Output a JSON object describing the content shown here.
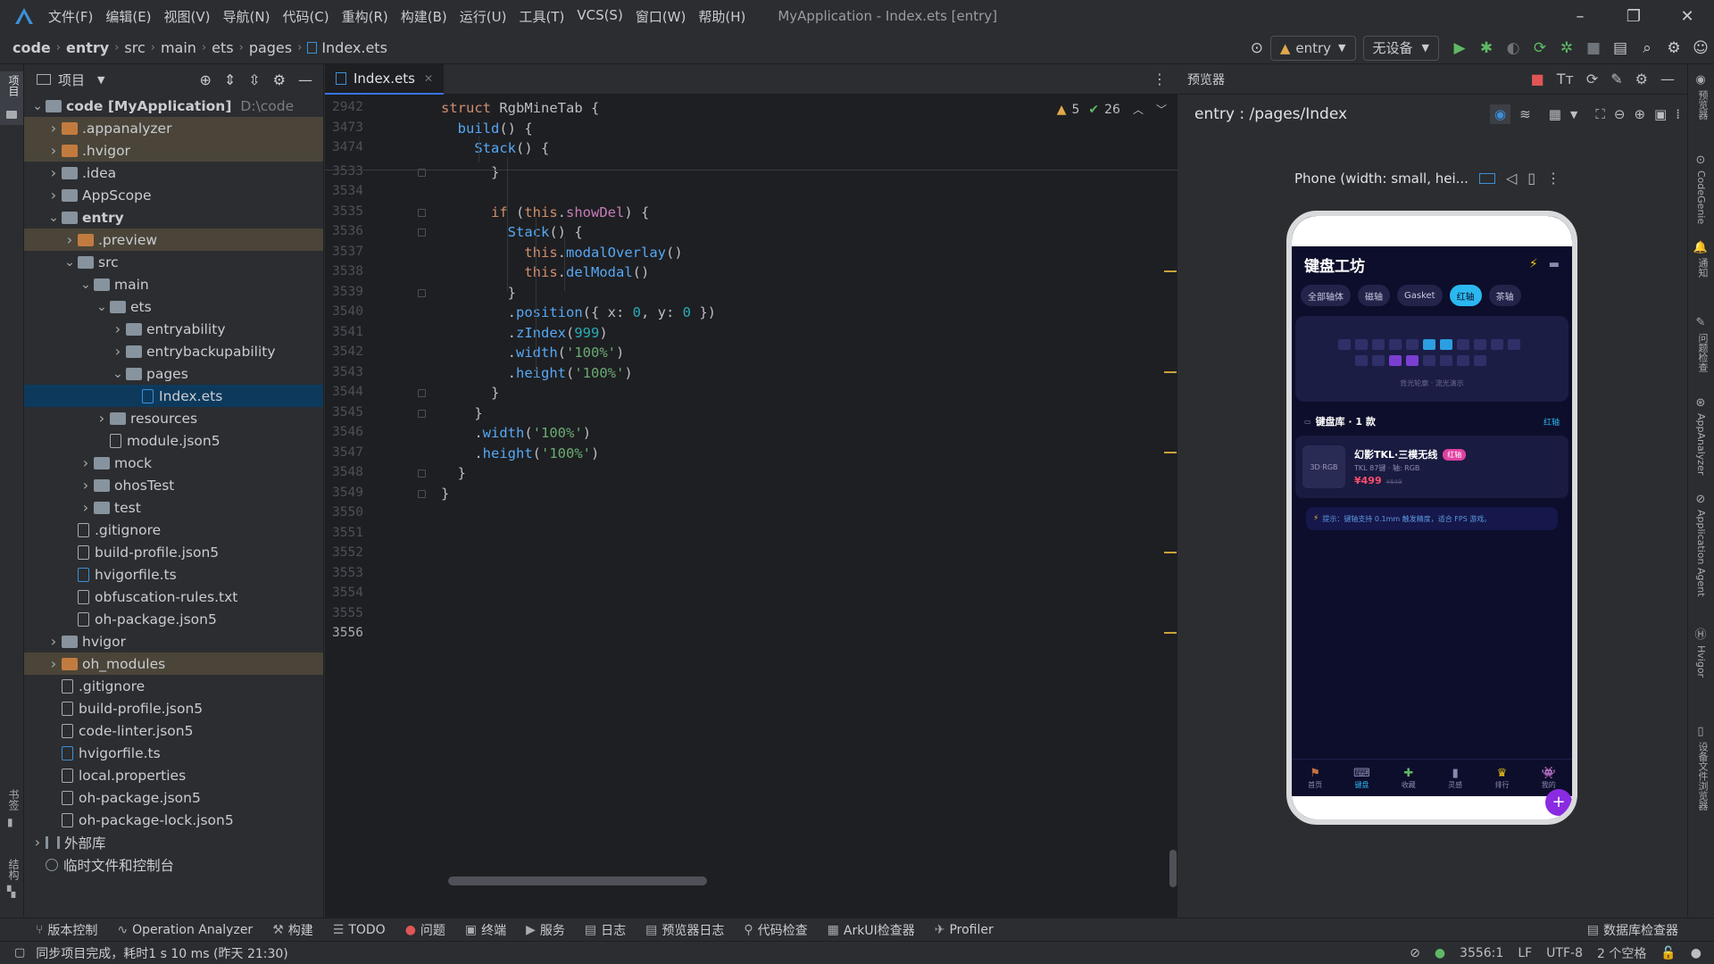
{
  "menu": [
    "文件(F)",
    "编辑(E)",
    "视图(V)",
    "导航(N)",
    "代码(C)",
    "重构(R)",
    "构建(B)",
    "运行(U)",
    "工具(T)",
    "VCS(S)",
    "窗口(W)",
    "帮助(H)"
  ],
  "window_title": "MyApplication - Index.ets [entry]",
  "breadcrumb": [
    "code",
    "entry",
    "src",
    "main",
    "ets",
    "pages",
    "Index.ets"
  ],
  "toolbar": {
    "module": "entry",
    "device": "无设备"
  },
  "left_strip": {
    "project": "项目",
    "bookmarks": "书签",
    "structure": "结构"
  },
  "project_panel": {
    "title": "项目",
    "tree": [
      {
        "label": "code [MyApplication]",
        "hint": "D:\\code",
        "depth": 0,
        "open": true,
        "kind": "folder"
      },
      {
        "label": ".appanalyzer",
        "depth": 1,
        "kind": "folder-orange",
        "excl": true
      },
      {
        "label": ".hvigor",
        "depth": 1,
        "kind": "folder-orange",
        "excl": true
      },
      {
        "label": ".idea",
        "depth": 1,
        "kind": "folder"
      },
      {
        "label": "AppScope",
        "depth": 1,
        "kind": "folder"
      },
      {
        "label": "entry",
        "depth": 1,
        "open": true,
        "kind": "folder",
        "bold": true
      },
      {
        "label": ".preview",
        "depth": 2,
        "kind": "folder-orange",
        "excl": true
      },
      {
        "label": "src",
        "depth": 2,
        "open": true,
        "kind": "folder"
      },
      {
        "label": "main",
        "depth": 3,
        "open": true,
        "kind": "folder"
      },
      {
        "label": "ets",
        "depth": 4,
        "open": true,
        "kind": "folder"
      },
      {
        "label": "entryability",
        "depth": 5,
        "kind": "folder"
      },
      {
        "label": "entrybackupability",
        "depth": 5,
        "kind": "folder"
      },
      {
        "label": "pages",
        "depth": 5,
        "open": true,
        "kind": "folder"
      },
      {
        "label": "Index.ets",
        "depth": 6,
        "kind": "file-ts",
        "selected": true,
        "leaf": true
      },
      {
        "label": "resources",
        "depth": 4,
        "kind": "folder"
      },
      {
        "label": "module.json5",
        "depth": 4,
        "kind": "file",
        "leaf": true
      },
      {
        "label": "mock",
        "depth": 3,
        "kind": "folder"
      },
      {
        "label": "ohosTest",
        "depth": 3,
        "kind": "folder"
      },
      {
        "label": "test",
        "depth": 3,
        "kind": "folder"
      },
      {
        "label": ".gitignore",
        "depth": 2,
        "kind": "file",
        "leaf": true
      },
      {
        "label": "build-profile.json5",
        "depth": 2,
        "kind": "file",
        "leaf": true
      },
      {
        "label": "hvigorfile.ts",
        "depth": 2,
        "kind": "file-ts",
        "leaf": true
      },
      {
        "label": "obfuscation-rules.txt",
        "depth": 2,
        "kind": "file",
        "leaf": true
      },
      {
        "label": "oh-package.json5",
        "depth": 2,
        "kind": "file",
        "leaf": true
      },
      {
        "label": "hvigor",
        "depth": 1,
        "kind": "folder"
      },
      {
        "label": "oh_modules",
        "depth": 1,
        "kind": "folder-orange",
        "excl": true
      },
      {
        "label": ".gitignore",
        "depth": 1,
        "kind": "file",
        "leaf": true
      },
      {
        "label": "build-profile.json5",
        "depth": 1,
        "kind": "file",
        "leaf": true
      },
      {
        "label": "code-linter.json5",
        "depth": 1,
        "kind": "file",
        "leaf": true
      },
      {
        "label": "hvigorfile.ts",
        "depth": 1,
        "kind": "file-ts",
        "leaf": true
      },
      {
        "label": "local.properties",
        "depth": 1,
        "kind": "file",
        "leaf": true
      },
      {
        "label": "oh-package.json5",
        "depth": 1,
        "kind": "file",
        "leaf": true
      },
      {
        "label": "oh-package-lock.json5",
        "depth": 1,
        "kind": "file",
        "leaf": true
      },
      {
        "label": "外部库",
        "depth": 0,
        "kind": "lib"
      },
      {
        "label": "临时文件和控制台",
        "depth": 0,
        "kind": "scratch",
        "leaf": true
      }
    ]
  },
  "editor": {
    "tab": "Index.ets",
    "warnings": "5",
    "checks": "26",
    "lines": [
      {
        "n": "2942",
        "html": "<span class='kw'>struct</span> <span class='ty'>RgbMineTab</span> {"
      },
      {
        "n": "3473",
        "html": "  <span class='fn'>build</span>() {"
      },
      {
        "n": "3474",
        "html": "    <span class='fn'>Stack</span>() {"
      },
      {
        "n": "3533",
        "html": "      }"
      },
      {
        "n": "3534",
        "html": ""
      },
      {
        "n": "3535",
        "html": "      <span class='kw'>if</span> (<span class='th'>this</span>.<span class='prop'>showDel</span>) {"
      },
      {
        "n": "3536",
        "html": "        <span class='fn'>Stack</span>() {"
      },
      {
        "n": "3537",
        "html": "          <span class='th'>this</span>.<span class='fn'>modalOverlay</span>()"
      },
      {
        "n": "3538",
        "html": "          <span class='th'>this</span>.<span class='fn'>delModal</span>()"
      },
      {
        "n": "3539",
        "html": "        }"
      },
      {
        "n": "3540",
        "html": "        .<span class='fn'>position</span>({ x: <span class='num'>0</span>, y: <span class='num'>0</span> })"
      },
      {
        "n": "3541",
        "html": "        .<span class='fn'>zIndex</span>(<span class='num'>999</span>)"
      },
      {
        "n": "3542",
        "html": "        .<span class='fn'>width</span>(<span class='str'>'100%'</span>)"
      },
      {
        "n": "3543",
        "html": "        .<span class='fn'>height</span>(<span class='str'>'100%'</span>)"
      },
      {
        "n": "3544",
        "html": "      }"
      },
      {
        "n": "3545",
        "html": "    }"
      },
      {
        "n": "3546",
        "html": "    .<span class='fn'>width</span>(<span class='str'>'100%'</span>)"
      },
      {
        "n": "3547",
        "html": "    .<span class='fn'>height</span>(<span class='str'>'100%'</span>)"
      },
      {
        "n": "3548",
        "html": "  }"
      },
      {
        "n": "3549",
        "html": "}"
      },
      {
        "n": "3550",
        "html": ""
      },
      {
        "n": "3551",
        "html": ""
      },
      {
        "n": "3552",
        "html": ""
      },
      {
        "n": "3553",
        "html": ""
      },
      {
        "n": "3554",
        "html": ""
      },
      {
        "n": "3555",
        "html": ""
      },
      {
        "n": "3556",
        "html": ""
      }
    ]
  },
  "preview": {
    "title": "预览器",
    "route": "entry : /pages/Index",
    "device": "Phone (width: small, hei...",
    "app": {
      "title": "键盘工坊",
      "chips": [
        "全部轴体",
        "磁轴",
        "Gasket",
        "红轴",
        "茶轴"
      ],
      "active_chip": "红轴",
      "banner_text": "背光轮廓 · 流光演示",
      "library_title": "键盘库 · 1 款",
      "library_filter": "红轴",
      "product": {
        "name": "幻影TKL·三模无线",
        "badge": "红轴",
        "spec": "TKL 87键 · 轴: RGB",
        "price": "¥499",
        "old_price": "¥649",
        "thumb": "3D·RGB"
      },
      "tip": "提示：键轴支持 0.1mm 触发精度，适合 FPS 游戏。",
      "tabs": [
        "首页",
        "键盘",
        "收藏",
        "灵感",
        "排行",
        "我的"
      ],
      "active_tab": "键盘"
    }
  },
  "right_strip": [
    "预览器",
    "CodeGenie",
    "通知",
    "问题检查",
    "AppAnalyzer",
    "Application Agent",
    "Hvigor",
    "设备文件浏览器"
  ],
  "bottom_tools": [
    "版本控制",
    "Operation Analyzer",
    "构建",
    "TODO",
    "问题",
    "终端",
    "服务",
    "日志",
    "预览器日志",
    "代码检查",
    "ArkUI检查器",
    "Profiler"
  ],
  "bottom_right": "数据库检查器",
  "status": {
    "message": "同步项目完成，耗时1 s 10 ms (昨天 21:30)",
    "pos": "3556:1",
    "eol": "LF",
    "enc": "UTF-8",
    "indent": "2 个空格"
  }
}
